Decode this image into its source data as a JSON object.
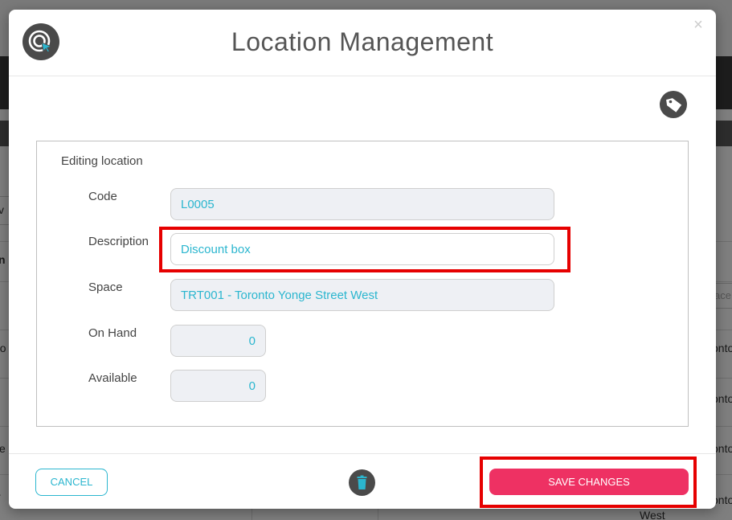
{
  "background": {
    "fragments": [
      "v",
      "n",
      "po",
      "ce",
      "r",
      "ace",
      "onto",
      "onto",
      "onto",
      "onto",
      "West"
    ]
  },
  "modal": {
    "title": "Location Management",
    "close_symbol": "×",
    "icons": {
      "logo": "target-cursor-icon",
      "tag": "tag-icon",
      "delete": "trash-icon",
      "close": "close-icon"
    },
    "form": {
      "section_title": "Editing location",
      "fields": {
        "code": {
          "label": "Code",
          "value": "L0005"
        },
        "description": {
          "label": "Description",
          "value": "Discount box"
        },
        "space": {
          "label": "Space",
          "value": "TRT001 - Toronto Yonge Street West"
        },
        "on_hand": {
          "label": "On Hand",
          "value": "0"
        },
        "available": {
          "label": "Available",
          "value": "0"
        }
      }
    },
    "footer": {
      "cancel_label": "CANCEL",
      "save_label": "SAVE CHANGES"
    }
  },
  "colors": {
    "accent": "#2bb6cf",
    "save": "#ee3163",
    "highlight": "#e60000",
    "icon_bg": "#4a4a4a"
  }
}
